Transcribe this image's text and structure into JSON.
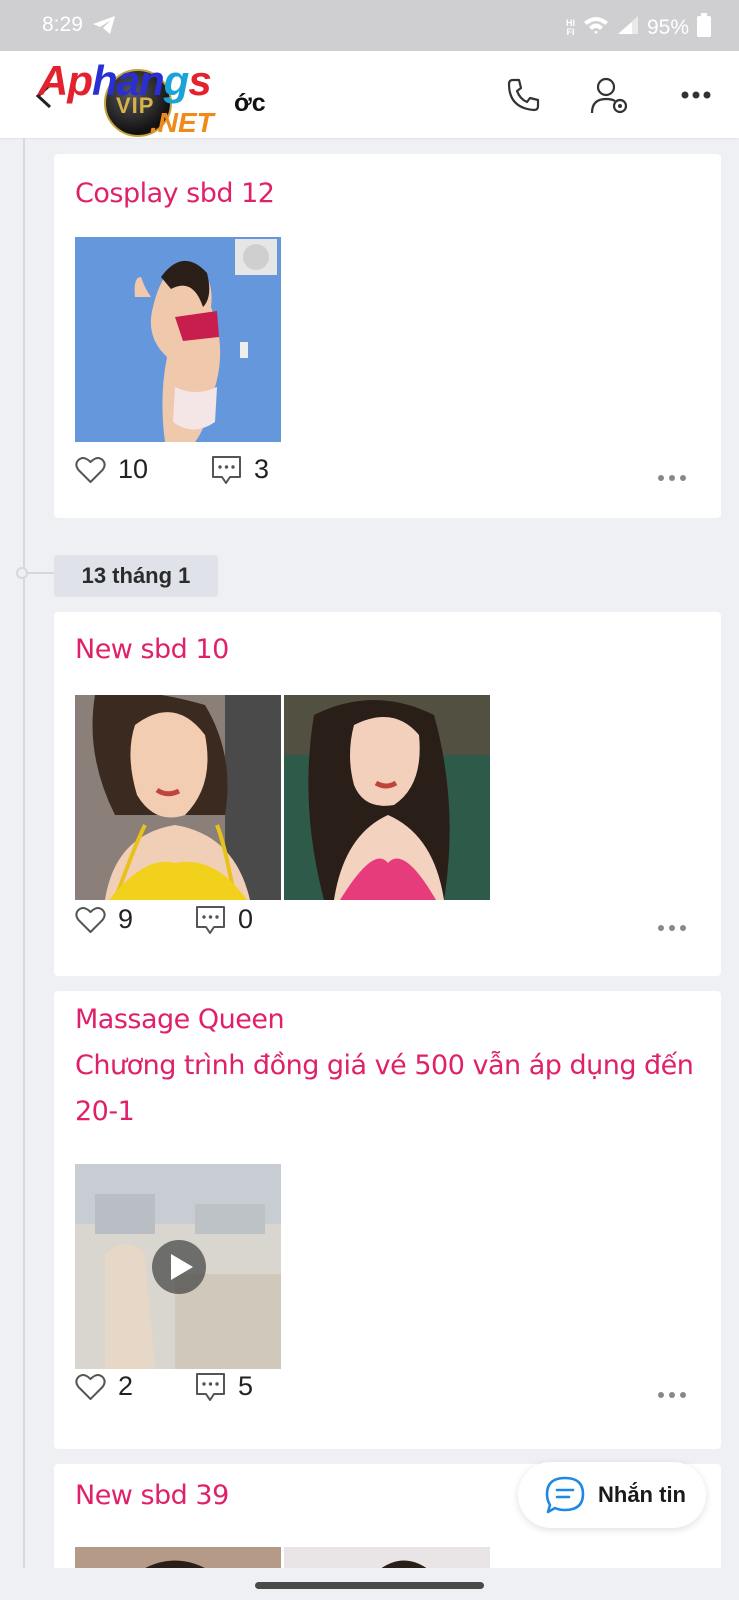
{
  "status_bar": {
    "time": "8:29",
    "battery": "95%"
  },
  "header": {
    "title_fragment": "ớc"
  },
  "date_separator": {
    "label": "13 tháng 1"
  },
  "posts": [
    {
      "title_lines": [
        "Cosplay sbd 12"
      ],
      "likes": "10",
      "comments": "3"
    },
    {
      "title_lines": [
        "New sbd 10"
      ],
      "likes": "9",
      "comments": "0"
    },
    {
      "title_lines": [
        "Massage Queen",
        "Chương trình đồng giá vé 500 vẫn áp dụng đến",
        "20-1"
      ],
      "likes": "2",
      "comments": "5"
    },
    {
      "title_lines": [
        "New sbd 39"
      ]
    }
  ],
  "message_button": {
    "label": "Nhắn tin"
  },
  "colors": {
    "accent_title": "#e0206a",
    "background": "#eef0f4",
    "chat_icon": "#1e88e5"
  }
}
